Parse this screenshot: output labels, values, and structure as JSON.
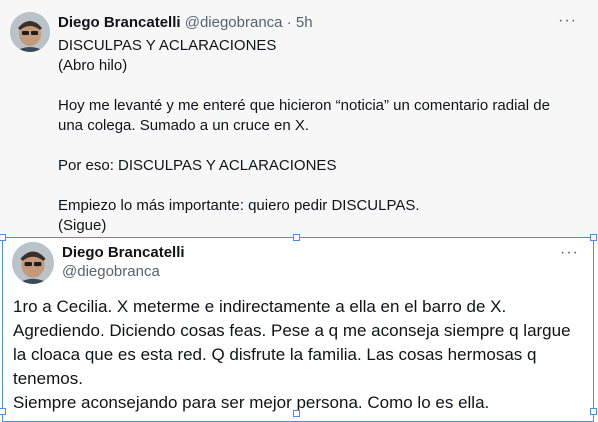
{
  "tweet1": {
    "author_name": "Diego Brancatelli",
    "author_handle": "@diegobranca",
    "time": "· 5h",
    "more": "···",
    "lines": {
      "l1": "DISCULPAS Y ACLARACIONES",
      "l2": "(Abro hilo)",
      "l3": "Hoy me levanté y me enteré que hicieron “noticia” un comentario radial de una colega. Sumado a un cruce en X.",
      "l4": "Por eso: DISCULPAS Y ACLARACIONES",
      "l5": "Empiezo lo más importante: quiero pedir DISCULPAS.",
      "l6": "(Sigue)"
    }
  },
  "tweet2": {
    "author_name": "Diego Brancatelli",
    "author_handle": "@diegobranca",
    "more": "···",
    "lines": {
      "l1": "1ro a Cecilia. X meterme e indirectamente a ella en el barro de X. Agrediendo. Diciendo cosas feas. Pese a q me aconseja siempre q largue la cloaca que es esta red. Q disfrute la familia. Las cosas hermosas q tenemos.",
      "l2": "Siempre aconsejando para ser mejor persona. Como lo es ella."
    }
  },
  "colors": {
    "text": "#0f1419",
    "secondary": "#536471",
    "selection": "#4a90e2",
    "tweet1_bg": "#f7f7f7"
  },
  "icons": {
    "more": "more-horizontal-icon"
  }
}
